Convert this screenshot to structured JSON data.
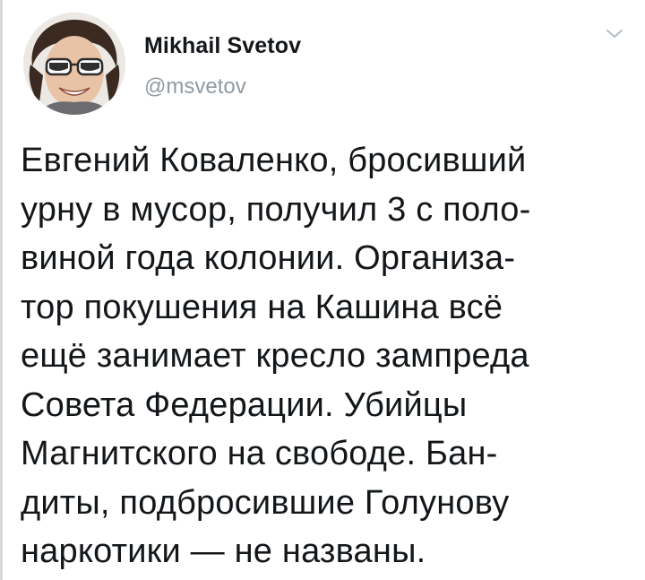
{
  "author": {
    "display_name": "Mikhail Svetov",
    "handle": "@msvetov",
    "avatar_icon": "profile-photo-avatar"
  },
  "tweet": {
    "text": "Евгений Коваленко, бросивший\nурну в мусор, получил 3 с поло-\nвиной года колонии. Организа-\nтор покушения на Кашина всё\nещё занимает кресло зампреда\nСовета Федерации. Убийцы\nМагнитского на свободе. Бан-\nдиты, подбросившие Голунову\nнаркотики — не названы."
  },
  "menu": {
    "icon": "chevron-down-icon"
  },
  "colors": {
    "text": "#14171a",
    "handle": "#8f9aa4",
    "chevron": "#b3bcc4",
    "background": "#ffffff"
  }
}
